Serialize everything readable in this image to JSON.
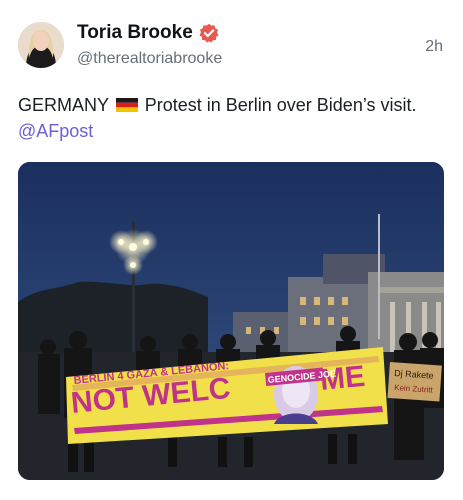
{
  "author": {
    "name": "Toria Brooke",
    "handle": "@therealtoriabrooke",
    "verified": true,
    "avatar_icon": "profile-photo"
  },
  "timestamp": "2h",
  "post": {
    "text_before_flag": "GERMANY",
    "flag_icon": "germany-flag-icon",
    "text_after_flag": "Protest in Berlin over Biden’s visit.",
    "mention": "@AFpost"
  },
  "media": {
    "banner_top": "BERLIN 4 GAZA & LEBANON:",
    "banner_main_left": "NOT WELC",
    "banner_main_right": "ME",
    "banner_badge": "GENOCIDE JOE",
    "sign_line1": "Dj Rakete",
    "sign_line2": "Kein Zutritt"
  },
  "colors": {
    "verified": "#e85a4f",
    "mention": "#6a5fd6",
    "banner_yellow": "#f2e04a",
    "banner_magenta": "#c0338a"
  }
}
